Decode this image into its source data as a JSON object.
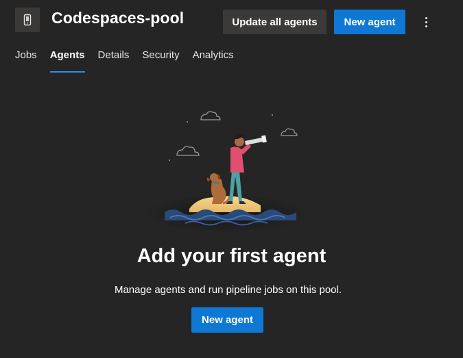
{
  "header": {
    "icon": "device-pool-icon",
    "title": "Codespaces-pool",
    "update_all_label": "Update all agents",
    "new_agent_label": "New agent",
    "more_icon": "more-vertical-icon"
  },
  "tabs": [
    {
      "label": "Jobs",
      "active": false
    },
    {
      "label": "Agents",
      "active": true
    },
    {
      "label": "Details",
      "active": false
    },
    {
      "label": "Security",
      "active": false
    },
    {
      "label": "Analytics",
      "active": false
    }
  ],
  "empty_state": {
    "illustration": "person-with-telescope-and-dog-on-island",
    "title": "Add your first agent",
    "description": "Manage agents and run pipeline jobs on this pool.",
    "button_label": "New agent"
  },
  "colors": {
    "background": "#262525",
    "primary": "#0f78d4",
    "secondary_button": "#3b3a39",
    "tab_underline": "#2b8fe8"
  }
}
